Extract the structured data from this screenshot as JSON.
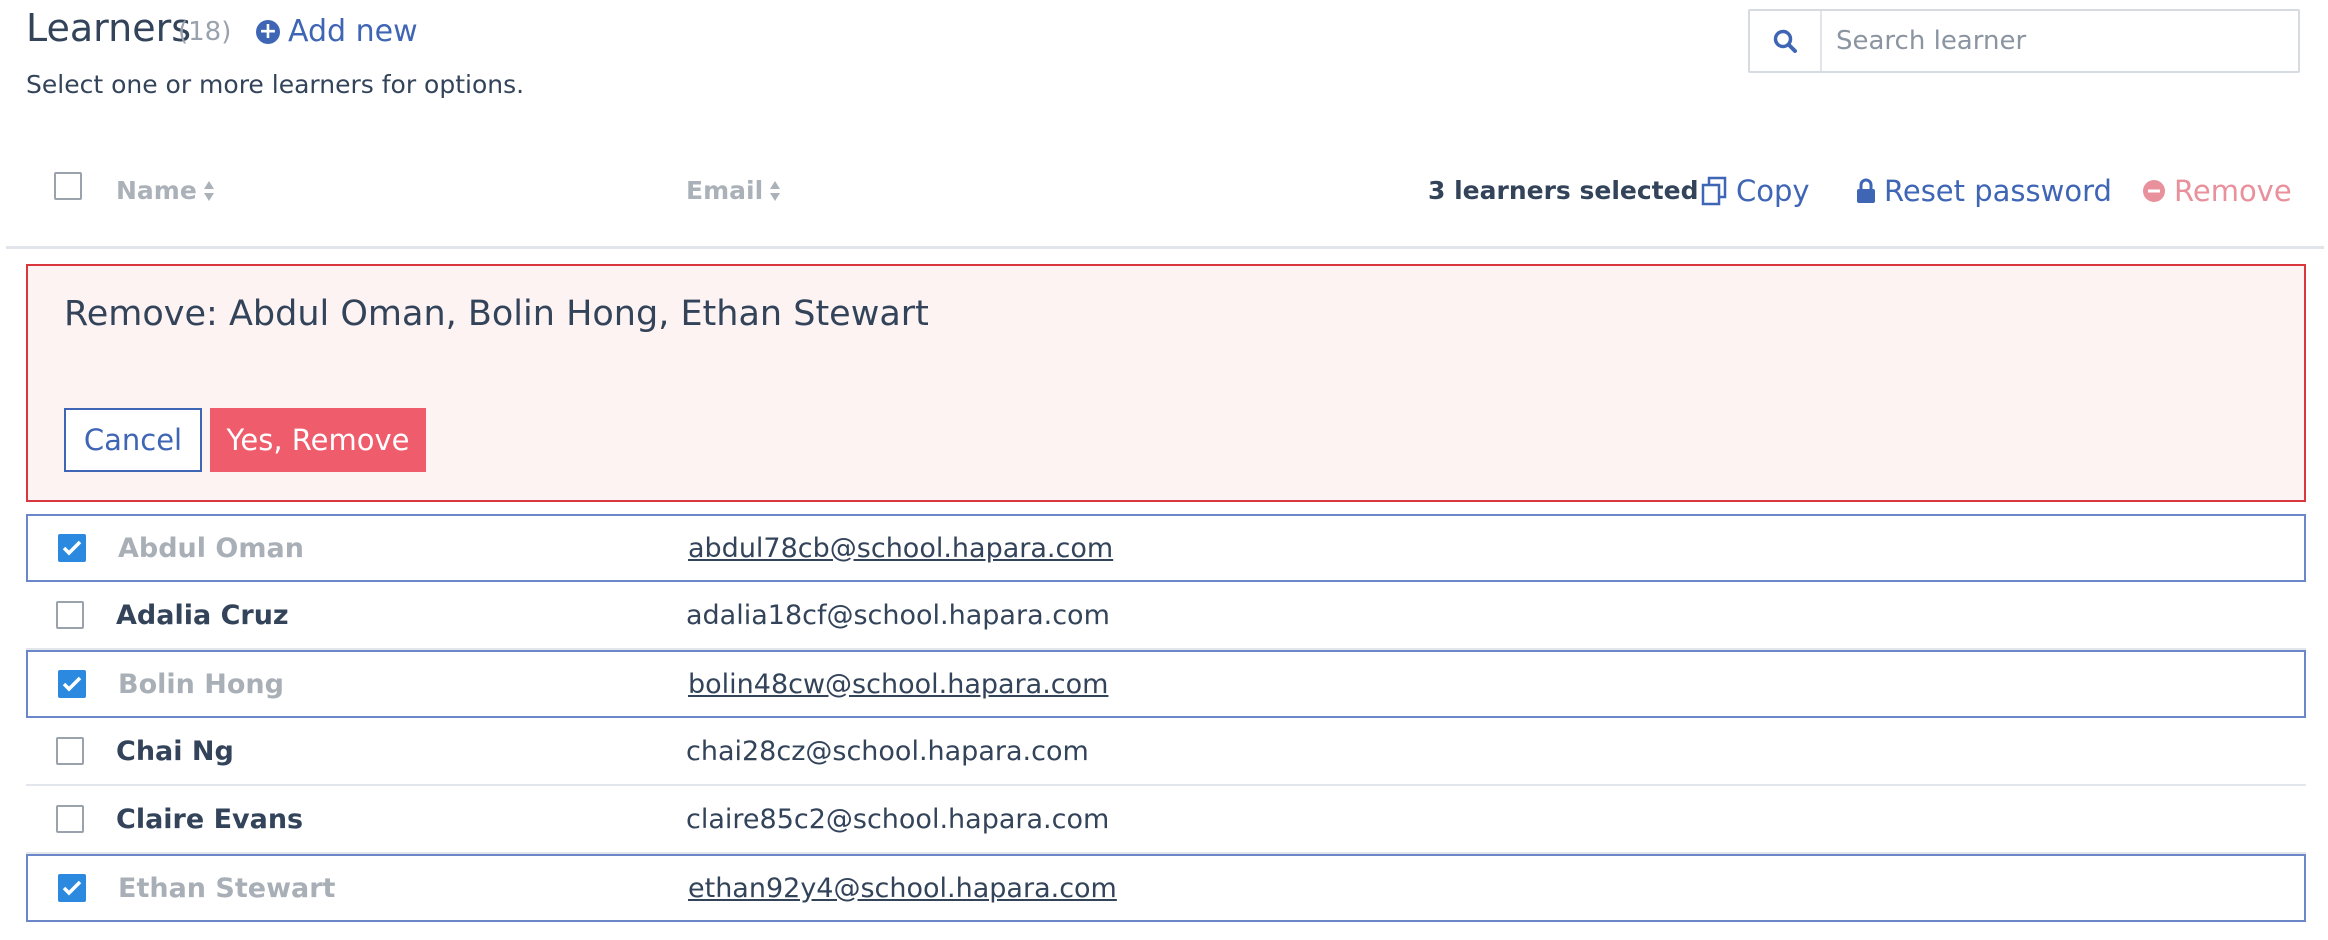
{
  "header": {
    "title": "Learners",
    "count": "(18)",
    "add_new_label": "Add new",
    "subtitle": "Select one or more learners for options."
  },
  "search": {
    "placeholder": "Search learner",
    "value": ""
  },
  "table_header": {
    "name_label": "Name",
    "email_label": "Email",
    "selected_count": "3 learners selected",
    "actions": {
      "copy": "Copy",
      "reset_password": "Reset password",
      "remove": "Remove"
    }
  },
  "confirm": {
    "text": "Remove: Abdul Oman, Bolin Hong, Ethan Stewart",
    "cancel_label": "Cancel",
    "yes_label": "Yes, Remove"
  },
  "rows": [
    {
      "name": "Abdul Oman",
      "email": "abdul78cb@school.hapara.com",
      "selected": true
    },
    {
      "name": "Adalia Cruz",
      "email": "adalia18cf@school.hapara.com",
      "selected": false
    },
    {
      "name": "Bolin Hong",
      "email": "bolin48cw@school.hapara.com",
      "selected": true
    },
    {
      "name": "Chai Ng",
      "email": "chai28cz@school.hapara.com",
      "selected": false
    },
    {
      "name": "Claire Evans",
      "email": "claire85c2@school.hapara.com",
      "selected": false
    },
    {
      "name": "Ethan Stewart",
      "email": "ethan92y4@school.hapara.com",
      "selected": true
    }
  ],
  "colors": {
    "accent": "#3f65b5",
    "danger": "#ef5d6c",
    "checkbox": "#2b8ae0"
  },
  "icons": {
    "add": "plus-circle-icon",
    "search": "search-icon",
    "sort": "sort-icon",
    "copy": "copy-icon",
    "lock": "lock-icon",
    "remove": "minus-circle-icon",
    "check": "check-icon"
  }
}
